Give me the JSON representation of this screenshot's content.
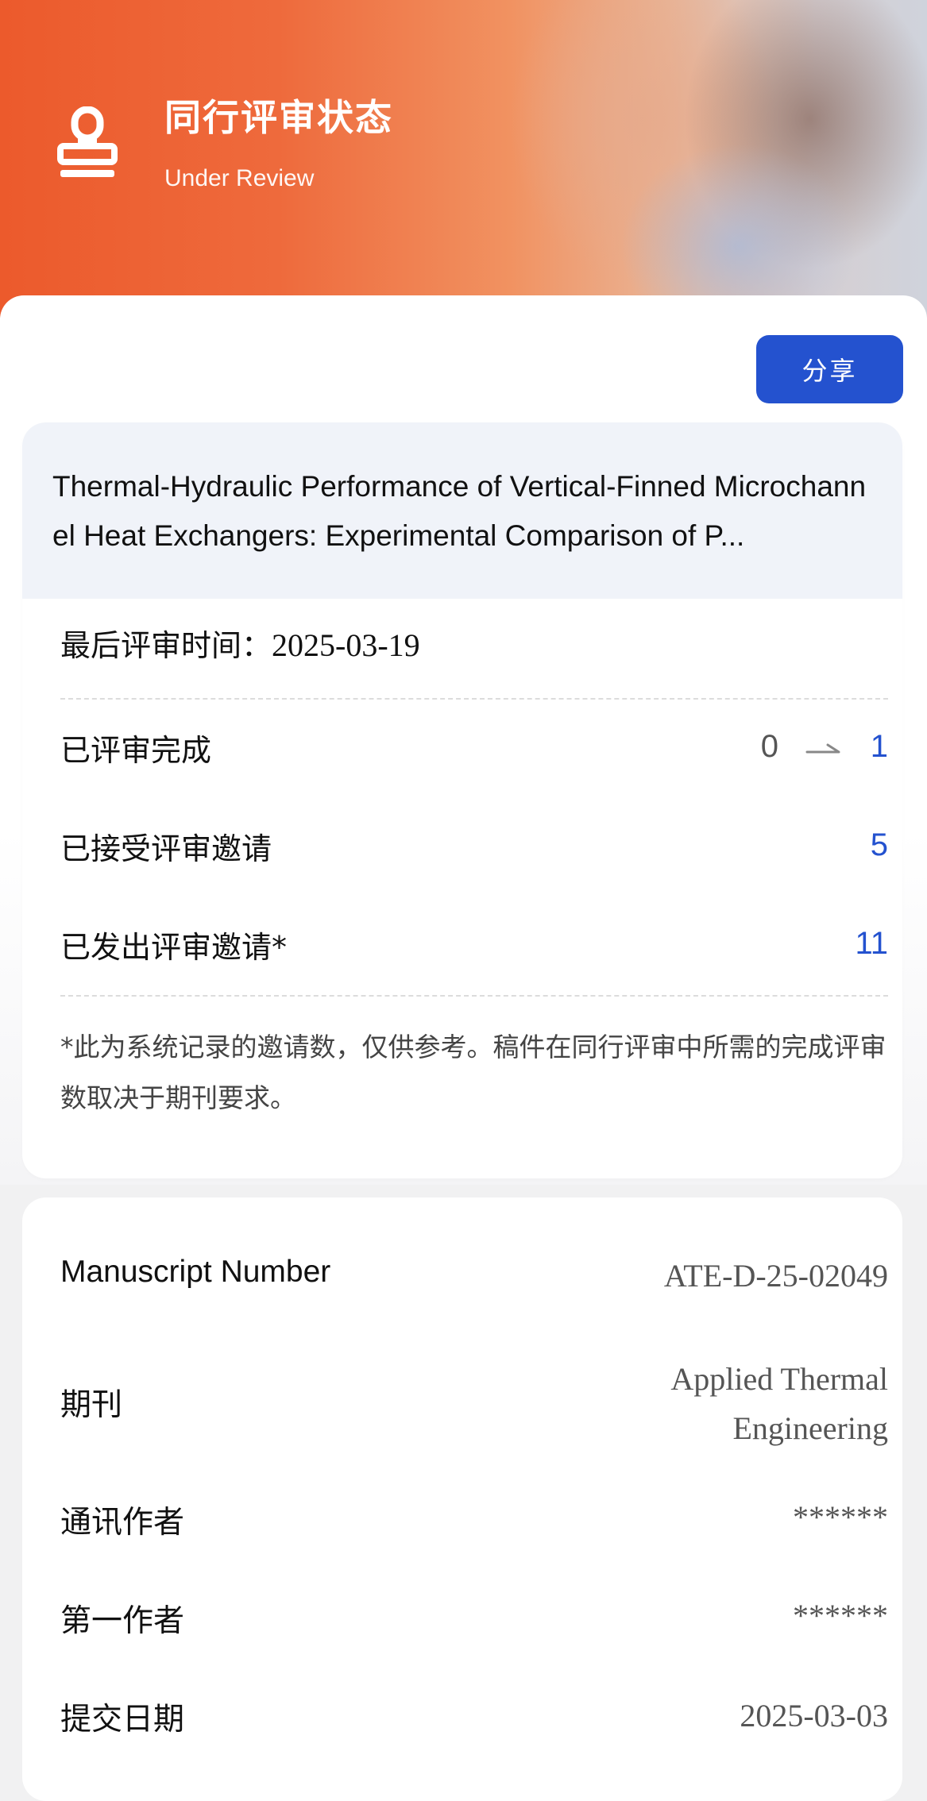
{
  "header": {
    "title": "同行评审状态",
    "subtitle": "Under Review",
    "icon": "stamp-icon",
    "gradient_start": "#ec5a2c"
  },
  "share_label": "分享",
  "paper": {
    "title": "Thermal-Hydraulic Performance of Vertical-Finned Microchannel Heat Exchangers: Experimental Comparison of P..."
  },
  "review": {
    "last_review_label": "最后评审时间：",
    "last_review_date": "2025-03-19",
    "completed_label": "已评审完成",
    "completed_prev": "0",
    "completed_now": "1",
    "accepted_label": "已接受评审邀请",
    "accepted_value": "5",
    "sent_label": "已发出评审邀请*",
    "sent_value": "11",
    "note": "*此为系统记录的邀请数，仅供参考。稿件在同行评审中所需的完成评审数取决于期刊要求。"
  },
  "details": {
    "manuscript_label": "Manuscript Number",
    "manuscript_value": "ATE-D-25-02049",
    "journal_label": "期刊",
    "journal_value_line1": "Applied Thermal",
    "journal_value_line2": "Engineering",
    "corresponding_label": "通讯作者",
    "corresponding_value": "******",
    "first_author_label": "第一作者",
    "first_author_value": "******",
    "submit_label": "提交日期",
    "submit_value": "2025-03-03"
  },
  "colors": {
    "accent_blue": "#2452cf",
    "header_orange": "#ec5a2c"
  }
}
